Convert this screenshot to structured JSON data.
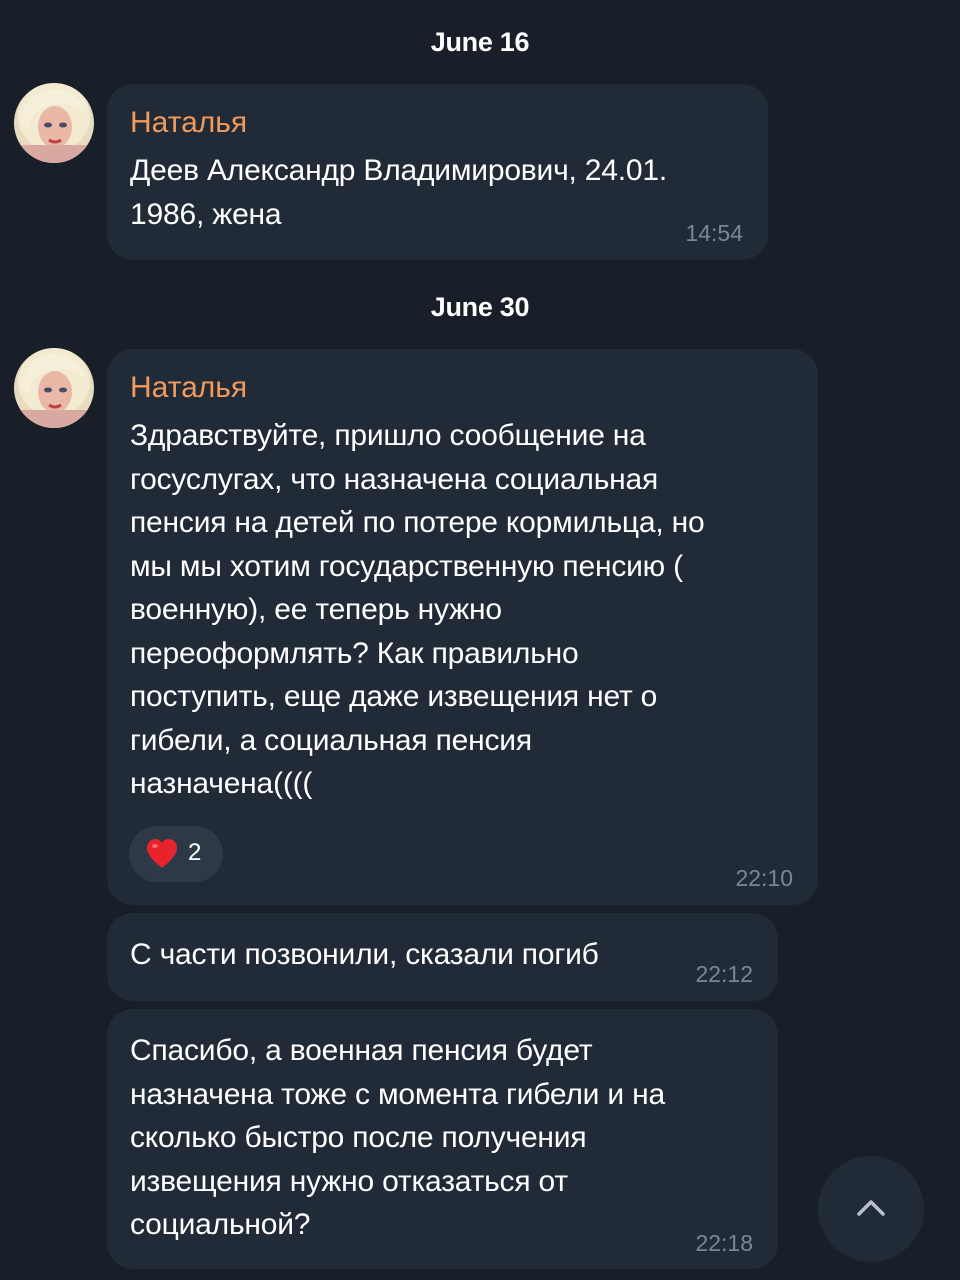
{
  "chat": {
    "dates": [
      "June 16",
      "June 30"
    ],
    "messages": [
      {
        "sender": "Наталья",
        "text": "Деев Александр Владимирович, 24.01.\n1986, жена",
        "time": "14:54"
      },
      {
        "sender": "Наталья",
        "text": "Здравствуйте, пришло сообщение на\nгосуслугах, что назначена социальная\nпенсия на детей по потере кормильца, но\nмы мы хотим государственную пенсию (\nвоенную), ее теперь нужно\nпереоформлять? Как правильно\nпоступить, еще даже извещения нет о\nгибели, а социальная пенсия\nназначена((((",
        "time": "22:10",
        "reaction": {
          "icon": "heart-icon",
          "count": "2"
        }
      },
      {
        "text": "С части позвонили, сказали погиб",
        "time": "22:12"
      },
      {
        "text": "Спасибо, а военная пенсия будет\nназначена тоже с момента гибели и на\nсколько быстро после получения\nизвещения нужно отказаться от\nсоциальной?",
        "time": "22:18"
      }
    ]
  },
  "scroll_button": {
    "icon": "chevron-up-icon"
  },
  "colors": {
    "background": "#181f29",
    "bubble": "#212b38",
    "sender_name": "#f19a5c",
    "timestamp": "#7b8694",
    "reaction_bg": "#2e3947",
    "heart": "#e8232c"
  }
}
